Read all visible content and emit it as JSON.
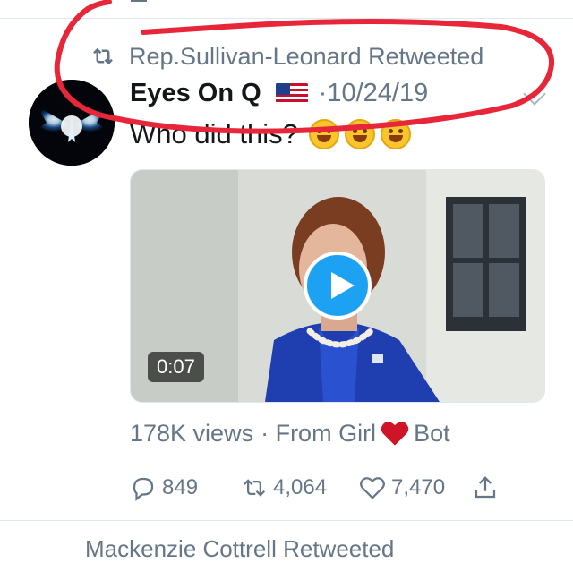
{
  "retweet_context": {
    "text": "Rep.Sullivan-Leonard Retweeted"
  },
  "tweet": {
    "author": "Eyes On Q",
    "date": "·10/24/19",
    "text": "Who did this?",
    "video_duration": "0:07",
    "views": "178K views",
    "from_prefix": "· From Girl",
    "from_suffix": "Bot"
  },
  "actions": {
    "replies": "849",
    "retweets": "4,064",
    "likes": "7,470"
  },
  "next_tweet": {
    "text": "Mackenzie Cottrell Retweeted"
  },
  "colors": {
    "annotation_red": "#e8263a",
    "twitter_blue": "#1da1f2",
    "muted_gray": "#657786"
  }
}
